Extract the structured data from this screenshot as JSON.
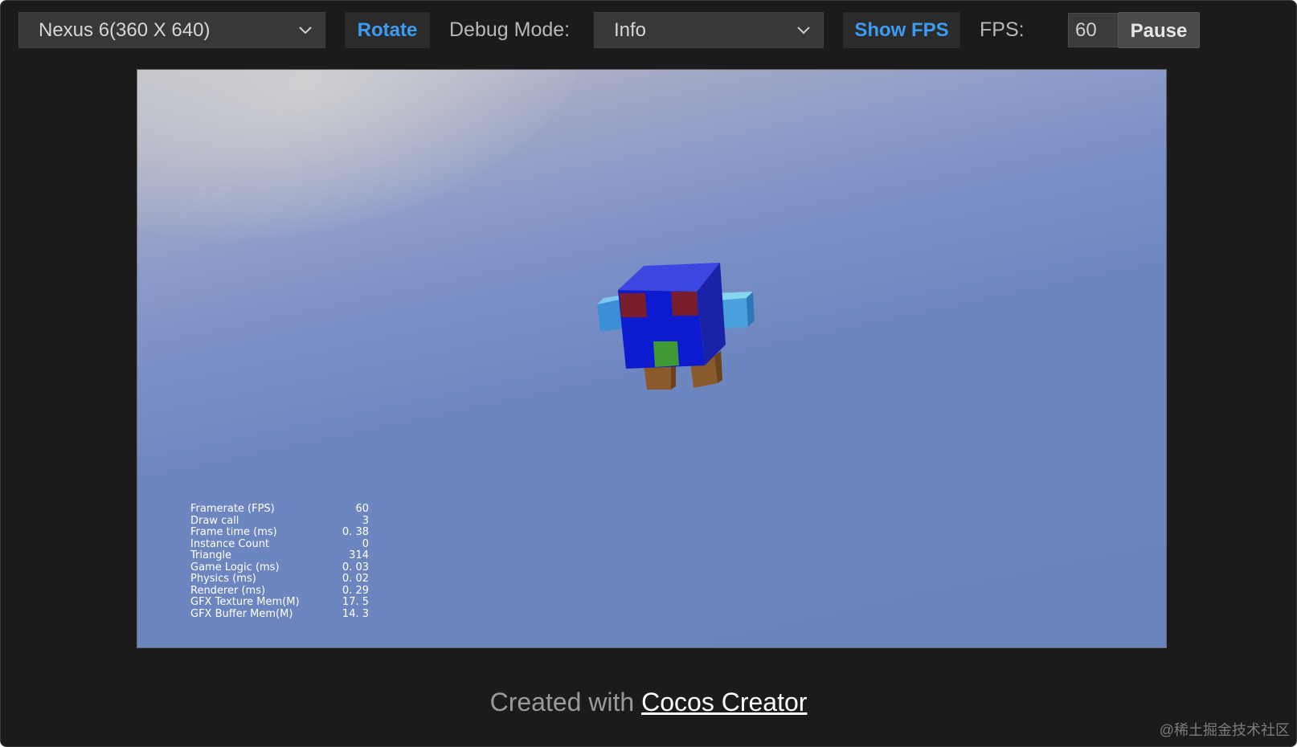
{
  "toolbar": {
    "device_select": "Nexus 6(360 X 640)",
    "rotate_label": "Rotate",
    "debug_mode_label": "Debug Mode:",
    "debug_mode_value": "Info",
    "show_fps_label": "Show FPS",
    "fps_label": "FPS:",
    "fps_value": "60",
    "pause_label": "Pause"
  },
  "stats": [
    {
      "label": "Framerate (FPS)",
      "value": "60"
    },
    {
      "label": "Draw call",
      "value": "3"
    },
    {
      "label": "Frame time (ms)",
      "value": "0. 38"
    },
    {
      "label": "Instance Count",
      "value": "0"
    },
    {
      "label": "Triangle",
      "value": "314"
    },
    {
      "label": "Game Logic (ms)",
      "value": "0. 03"
    },
    {
      "label": "Physics (ms)",
      "value": "0. 02"
    },
    {
      "label": "Renderer (ms)",
      "value": "0. 29"
    },
    {
      "label": "GFX Texture Mem(M)",
      "value": "17. 5"
    },
    {
      "label": "GFX Buffer Mem(M)",
      "value": "14. 3"
    }
  ],
  "footer": {
    "prefix": "Created with ",
    "link": "Cocos Creator"
  },
  "watermark": "@稀土掘金技术社区",
  "colors": {
    "accent": "#3b9cf2",
    "background": "#1b1b1b",
    "stage_sky": "#6b84bd"
  }
}
